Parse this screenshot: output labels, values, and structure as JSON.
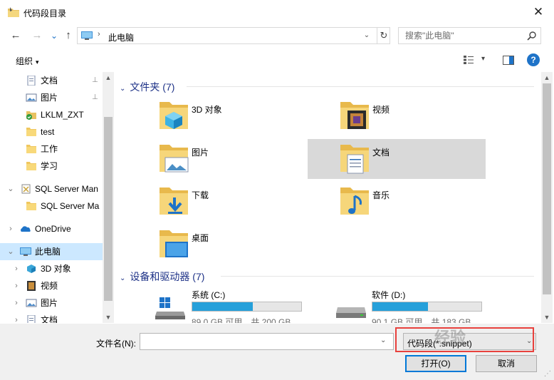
{
  "window": {
    "title": "代码段目录",
    "close_glyph": "✕"
  },
  "nav": {
    "back": "←",
    "forward": "→",
    "recent": "⌄",
    "up": "↑"
  },
  "address": {
    "breadcrumb_arrow": "›",
    "location": "此电脑",
    "dropdown": "⌄",
    "refresh": "↻"
  },
  "search": {
    "placeholder": "搜索\"此电脑\""
  },
  "toolbar": {
    "organize": "组织",
    "organize_caret": "▾",
    "view_caret": "▾",
    "help": "?"
  },
  "sidebar": {
    "items": [
      {
        "label": "文档",
        "icon": "document-icon",
        "pinned": true
      },
      {
        "label": "图片",
        "icon": "picture-icon",
        "pinned": true
      },
      {
        "label": "LKLM_ZXT",
        "icon": "sync-folder-icon",
        "pinned": false
      },
      {
        "label": "test",
        "icon": "folder-icon",
        "pinned": false
      },
      {
        "label": "工作",
        "icon": "folder-icon",
        "pinned": false
      },
      {
        "label": "学习",
        "icon": "folder-icon",
        "pinned": false
      },
      {
        "label": "SQL Server Man",
        "icon": "sql-server-icon",
        "pinned": false
      },
      {
        "label": "SQL Server Ma",
        "icon": "folder-icon",
        "pinned": false
      },
      {
        "label": "OneDrive",
        "icon": "onedrive-icon",
        "pinned": false
      },
      {
        "label": "此电脑",
        "icon": "computer-icon",
        "pinned": false
      },
      {
        "label": "3D 对象",
        "icon": "3d-objects-icon",
        "pinned": false
      },
      {
        "label": "视频",
        "icon": "video-icon",
        "pinned": false
      },
      {
        "label": "图片",
        "icon": "picture-icon",
        "pinned": false
      },
      {
        "label": "文档",
        "icon": "document-icon",
        "pinned": false
      }
    ],
    "pin_glyph": "📌",
    "expand_closed": "›",
    "expand_open": "⌄"
  },
  "content": {
    "folders_header": "文件夹 (7)",
    "folders": [
      {
        "name": "3D 对象",
        "icon": "3d-objects-icon"
      },
      {
        "name": "视频",
        "icon": "video-icon"
      },
      {
        "name": "图片",
        "icon": "picture-icon"
      },
      {
        "name": "文档",
        "icon": "document-icon"
      },
      {
        "name": "下载",
        "icon": "download-icon"
      },
      {
        "name": "音乐",
        "icon": "music-icon"
      },
      {
        "name": "桌面",
        "icon": "desktop-icon"
      }
    ],
    "drives_header": "设备和驱动器 (7)",
    "drives": [
      {
        "name": "系统 (C:)",
        "info": "89.0 GB 可用，共 200 GB",
        "used_fraction": 0.555,
        "icon": "windows-drive-icon"
      },
      {
        "name": "软件 (D:)",
        "info": "90.1 GB 可用，共 183 GB",
        "used_fraction": 0.508,
        "icon": "drive-icon"
      }
    ]
  },
  "bottom": {
    "filename_label": "文件名(N):",
    "filename_value": "",
    "filter_value": "代码段(*.snippet)",
    "open_label": "打开(O)",
    "cancel_label": "取消",
    "watermark": "经验"
  },
  "colors": {
    "accent": "#0078d7",
    "header_text": "#1e3287",
    "highlight_box": "#e8413d",
    "drive_bar": "#26a0da",
    "selected": "#cce8ff"
  }
}
